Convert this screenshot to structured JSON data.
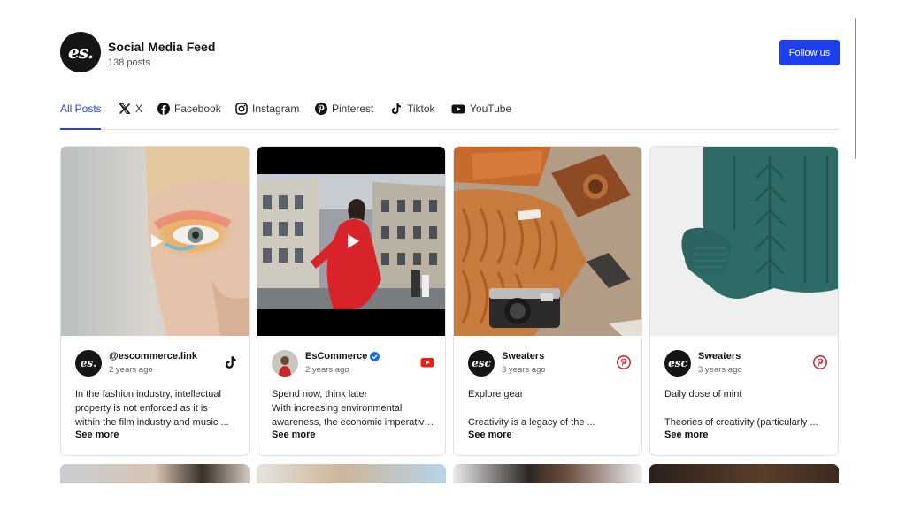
{
  "header": {
    "logo_text": "es.",
    "title": "Social Media Feed",
    "post_count": "138 posts",
    "follow_label": "Follow us",
    "accent_color": "#1d3ff0"
  },
  "tabs": [
    {
      "label": "All Posts",
      "active": true
    },
    {
      "label": "X",
      "icon": "x-icon"
    },
    {
      "label": "Facebook",
      "icon": "facebook-icon"
    },
    {
      "label": "Instagram",
      "icon": "instagram-icon"
    },
    {
      "label": "Pinterest",
      "icon": "pinterest-icon"
    },
    {
      "label": "Tiktok",
      "icon": "tiktok-icon"
    },
    {
      "label": "YouTube",
      "icon": "youtube-icon"
    }
  ],
  "posts": [
    {
      "author": "@escommerce.link",
      "time": "2 years ago",
      "source": "tiktok-icon",
      "avatar_text": "es.",
      "lines": [
        "In the fashion industry, intellectual",
        "property is not enforced as it is",
        "within the film industry and music ..."
      ],
      "see_more": "See more",
      "media": "video"
    },
    {
      "author": "EsCommerce",
      "verified": true,
      "time": "2 years ago",
      "source": "youtube-icon",
      "lines": [
        "Spend now, think later",
        "With increasing environmental",
        "awareness, the economic imperative..."
      ],
      "see_more": "See more",
      "media": "video"
    },
    {
      "author": "Sweaters",
      "time": "3 years ago",
      "source": "pinterest-icon",
      "avatar_text": "esc",
      "lines": [
        "Explore gear",
        "",
        "Creativity is a legacy of the ..."
      ],
      "see_more": "See more",
      "media": "image"
    },
    {
      "author": "Sweaters",
      "time": "3 years ago",
      "source": "pinterest-icon",
      "avatar_text": "esc",
      "lines": [
        "Daily dose of mint",
        "",
        "Theories of creativity (particularly ..."
      ],
      "see_more": "See more",
      "media": "image"
    }
  ],
  "colors": {
    "youtube": "#e62117",
    "pinterest": "#c8232c",
    "verified": "#1d6fe0",
    "active_tab": "#2b47c9"
  }
}
